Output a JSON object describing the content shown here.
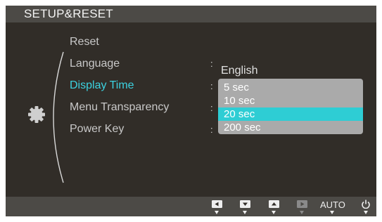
{
  "header": {
    "title": "SETUP&RESET"
  },
  "menu": {
    "items": [
      {
        "label": "Reset"
      },
      {
        "label": "Language"
      },
      {
        "label": "Display Time"
      },
      {
        "label": "Menu Transparency"
      },
      {
        "label": "Power Key"
      }
    ],
    "selected": "Display Time"
  },
  "values": {
    "language": "English",
    "colon": ":"
  },
  "dropdown": {
    "options": [
      "5 sec",
      "10 sec",
      "20 sec",
      "200 sec"
    ],
    "highlighted": "20 sec"
  },
  "bottom_bar": {
    "buttons": [
      {
        "icon": "left-arrow-icon",
        "enabled": true
      },
      {
        "icon": "down-arrow-icon",
        "enabled": true
      },
      {
        "icon": "up-arrow-icon",
        "enabled": true
      },
      {
        "icon": "right-arrow-icon",
        "enabled": false
      },
      {
        "label": "AUTO",
        "enabled": true
      },
      {
        "icon": "power-icon",
        "enabled": true
      }
    ]
  },
  "colors": {
    "background": "#312d28",
    "bar": "#4c4a46",
    "accent": "#3cd2e0",
    "highlight": "#2ecdd4",
    "dropdown": "#aaaaaa"
  }
}
